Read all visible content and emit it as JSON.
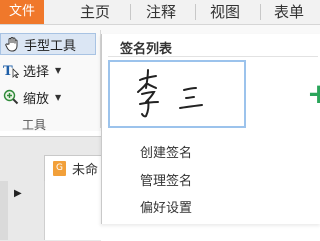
{
  "menubar": {
    "file_label": "文件",
    "items": [
      {
        "label": "主页"
      },
      {
        "label": "注释"
      },
      {
        "label": "视图"
      },
      {
        "label": "表单"
      }
    ]
  },
  "tools": {
    "hand": "手型工具",
    "select": "选择",
    "zoom": "缩放",
    "group_label": "工具"
  },
  "signature_panel": {
    "title": "签名列表",
    "menu": [
      "创建签名",
      "管理签名",
      "偏好设置"
    ]
  },
  "document": {
    "tab_label": "未命",
    "file_icon_letter": "G"
  },
  "colors": {
    "file_tab": "#f0782b",
    "add_signature": "#2aa55a",
    "signature_border": "#9cc3ec"
  }
}
